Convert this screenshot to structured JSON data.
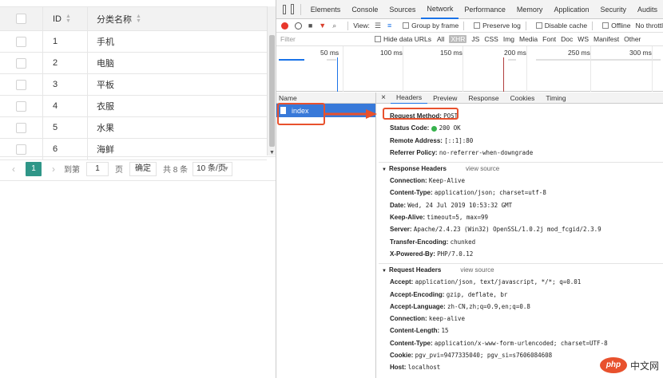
{
  "table": {
    "headers": {
      "id": "ID",
      "name": "分类名称"
    },
    "rows": [
      {
        "id": "1",
        "name": "手机"
      },
      {
        "id": "2",
        "name": "电脑"
      },
      {
        "id": "3",
        "name": "平板"
      },
      {
        "id": "4",
        "name": "衣服"
      },
      {
        "id": "5",
        "name": "水果"
      },
      {
        "id": "6",
        "name": "海鲜"
      }
    ]
  },
  "pager": {
    "current": "1",
    "goto_label": "到第",
    "goto_value": "1",
    "page_unit": "页",
    "confirm": "确定",
    "total": "共 8 条",
    "page_size": "10 条/页"
  },
  "devtools": {
    "tabs": [
      "Elements",
      "Console",
      "Sources",
      "Network",
      "Performance",
      "Memory",
      "Application",
      "Security",
      "Audits"
    ],
    "active_tab": "Network",
    "toolbar": {
      "view": "View:",
      "group_by_frame": "Group by frame",
      "preserve_log": "Preserve log",
      "disable_cache": "Disable cache",
      "offline": "Offline",
      "throttle": "No throttl"
    },
    "filter": {
      "placeholder": "Filter",
      "hide_data_urls": "Hide data URLs",
      "types": [
        "All",
        "XHR",
        "JS",
        "CSS",
        "Img",
        "Media",
        "Font",
        "Doc",
        "WS",
        "Manifest",
        "Other"
      ],
      "selected_type": "XHR"
    },
    "timeline_labels": [
      "50 ms",
      "100 ms",
      "150 ms",
      "200 ms",
      "250 ms",
      "300 ms"
    ],
    "name_header": "Name",
    "request_name": "index",
    "detail_tabs": [
      "Headers",
      "Preview",
      "Response",
      "Cookies",
      "Timing"
    ],
    "active_detail_tab": "Headers",
    "general": [
      {
        "k": "Request Method:",
        "v": "POST"
      },
      {
        "k": "Status Code:",
        "v": "200 OK"
      },
      {
        "k": "Remote Address:",
        "v": "[::1]:80"
      },
      {
        "k": "Referrer Policy:",
        "v": "no-referrer-when-downgrade"
      }
    ],
    "response_headers_title": "Response Headers",
    "request_headers_title": "Request Headers",
    "view_source": "view source",
    "response_headers": [
      {
        "k": "Connection:",
        "v": "Keep-Alive"
      },
      {
        "k": "Content-Type:",
        "v": "application/json; charset=utf-8"
      },
      {
        "k": "Date:",
        "v": "Wed, 24 Jul 2019 10:53:32 GMT"
      },
      {
        "k": "Keep-Alive:",
        "v": "timeout=5, max=99"
      },
      {
        "k": "Server:",
        "v": "Apache/2.4.23 (Win32) OpenSSL/1.0.2j mod_fcgid/2.3.9"
      },
      {
        "k": "Transfer-Encoding:",
        "v": "chunked"
      },
      {
        "k": "X-Powered-By:",
        "v": "PHP/7.0.12"
      }
    ],
    "request_headers": [
      {
        "k": "Accept:",
        "v": "application/json, text/javascript, */*; q=0.01"
      },
      {
        "k": "Accept-Encoding:",
        "v": "gzip, deflate, br"
      },
      {
        "k": "Accept-Language:",
        "v": "zh-CN,zh;q=0.9,en;q=0.8"
      },
      {
        "k": "Connection:",
        "v": "keep-alive"
      },
      {
        "k": "Content-Length:",
        "v": "15"
      },
      {
        "k": "Content-Type:",
        "v": "application/x-www-form-urlencoded; charset=UTF-8"
      },
      {
        "k": "Cookie:",
        "v": "pgv_pvi=9477335040; pgv_si=s7606084608"
      },
      {
        "k": "Host:",
        "v": "localhost"
      }
    ]
  },
  "watermark": {
    "logo": "php",
    "text": "中文网"
  },
  "colors": {
    "accent": "#2f9688",
    "highlight": "#e8512d",
    "selected_row": "#3879d9"
  }
}
